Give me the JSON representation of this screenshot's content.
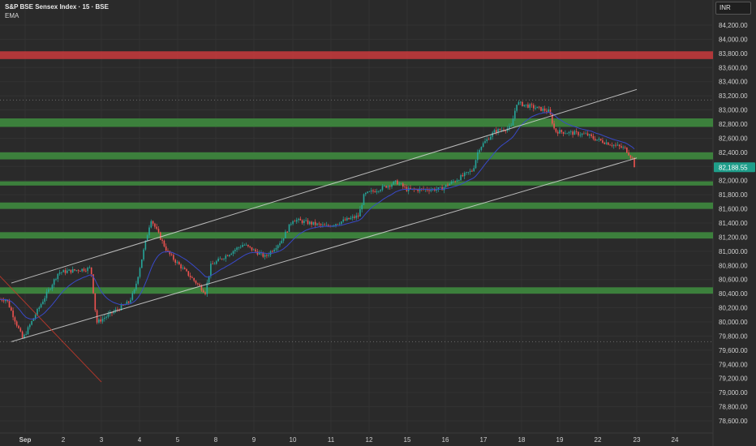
{
  "header": {
    "title": "S&P BSE Sensex Index · 15 · BSE",
    "indicator": "EMA",
    "currency": "INR"
  },
  "colors": {
    "background": "#2a2a2a",
    "grid": "#333333",
    "axis_text": "#d0d0d0",
    "support_zone": "#3f8f3f",
    "resistance_zone": "#c0393b",
    "channel": "#d4d4d4",
    "down_trend": "#c0392b",
    "ema": "#3949c8",
    "candle_up": "#26a69a",
    "candle_down": "#ef5350",
    "price_tag": "#1f9e8a"
  },
  "chart_data": {
    "type": "candlestick",
    "title": "S&P BSE Sensex Index · 15 · BSE",
    "indicator": "EMA",
    "currency": "INR",
    "x_tick_labels": [
      "Sep",
      "2",
      "3",
      "4",
      "5",
      "8",
      "9",
      "10",
      "11",
      "12",
      "15",
      "16",
      "17",
      "18",
      "19",
      "22",
      "23",
      "24"
    ],
    "y_ticks": [
      78600,
      78800,
      79000,
      79200,
      79400,
      79600,
      79800,
      80000,
      80200,
      80400,
      80600,
      80800,
      81000,
      81200,
      81400,
      81600,
      81800,
      82000,
      82200,
      82400,
      82600,
      82800,
      83000,
      83200,
      83400,
      83600,
      83800,
      84000,
      84200
    ],
    "y_tick_labels": [
      "78,600.00",
      "78,800.00",
      "79,000.00",
      "79,200.00",
      "79,400.00",
      "79,600.00",
      "79,800.00",
      "80,000.00",
      "80,200.00",
      "80,400.00",
      "80,600.00",
      "80,800.00",
      "81,000.00",
      "81,200.00",
      "81,400.00",
      "81,600.00",
      "81,800.00",
      "82,000.00",
      "82,200.00",
      "82,400.00",
      "82,600.00",
      "82,800.00",
      "83,000.00",
      "83,200.00",
      "83,400.00",
      "83,600.00",
      "83,800.00",
      "84,000.00",
      "84,200.00"
    ],
    "ylim": [
      78480,
      84430
    ],
    "last_price": 82188.55,
    "last_price_label": "82,188.55",
    "dotted_reference_levels": [
      79720,
      83140
    ],
    "resistance_zones": [
      {
        "low": 83720,
        "high": 83830
      }
    ],
    "support_zones": [
      {
        "low": 82760,
        "high": 82880
      },
      {
        "low": 82300,
        "high": 82400
      },
      {
        "low": 81930,
        "high": 81990
      },
      {
        "low": 81600,
        "high": 81690
      },
      {
        "low": 81180,
        "high": 81270
      },
      {
        "low": 80400,
        "high": 80490
      }
    ],
    "trendlines": [
      {
        "role": "channel-upper",
        "from": [
          "Sep 1",
          80550
        ],
        "to": [
          "Sep 23",
          83290
        ]
      },
      {
        "role": "channel-lower",
        "from": [
          "Sep 1",
          79720
        ],
        "to": [
          "Sep 23",
          82320
        ]
      },
      {
        "role": "downtrend",
        "from": [
          "Aug 29",
          80790
        ],
        "to": [
          "Sep 3",
          79150
        ]
      }
    ],
    "price_path": [
      {
        "date": "Sep 1",
        "price": 80320
      },
      {
        "date": "Sep 1",
        "price": 79760
      },
      {
        "date": "Sep 1",
        "price": 80200
      },
      {
        "date": "Sep 2",
        "price": 80700
      },
      {
        "date": "Sep 2",
        "price": 80760
      },
      {
        "date": "Sep 3",
        "price": 79990
      },
      {
        "date": "Sep 3",
        "price": 80280
      },
      {
        "date": "Sep 4",
        "price": 80450
      },
      {
        "date": "Sep 4",
        "price": 81460
      },
      {
        "date": "Sep 4",
        "price": 81000
      },
      {
        "date": "Sep 5",
        "price": 80900
      },
      {
        "date": "Sep 5",
        "price": 80420
      },
      {
        "date": "Sep 8",
        "price": 80800
      },
      {
        "date": "Sep 8",
        "price": 81100
      },
      {
        "date": "Sep 9",
        "price": 81050
      },
      {
        "date": "Sep 9",
        "price": 80920
      },
      {
        "date": "Sep 9",
        "price": 81150
      },
      {
        "date": "Sep 10",
        "price": 81450
      },
      {
        "date": "Sep 11",
        "price": 81350
      },
      {
        "date": "Sep 11",
        "price": 81500
      },
      {
        "date": "Sep 12",
        "price": 81800
      },
      {
        "date": "Sep 12",
        "price": 81980
      },
      {
        "date": "Sep 15",
        "price": 81870
      },
      {
        "date": "Sep 16",
        "price": 81880
      },
      {
        "date": "Sep 16",
        "price": 82150
      },
      {
        "date": "Sep 17",
        "price": 82450
      },
      {
        "date": "Sep 17",
        "price": 82700
      },
      {
        "date": "Sep 17",
        "price": 82750
      },
      {
        "date": "Sep 18",
        "price": 83100
      },
      {
        "date": "Sep 18",
        "price": 82980
      },
      {
        "date": "Sep 19",
        "price": 82700
      },
      {
        "date": "Sep 19",
        "price": 82650
      },
      {
        "date": "Sep 22",
        "price": 82600
      },
      {
        "date": "Sep 22",
        "price": 82450
      },
      {
        "date": "Sep 23",
        "price": 82320
      },
      {
        "date": "Sep 23",
        "price": 82100
      },
      {
        "date": "Sep 23",
        "price": 82188.55
      }
    ]
  }
}
